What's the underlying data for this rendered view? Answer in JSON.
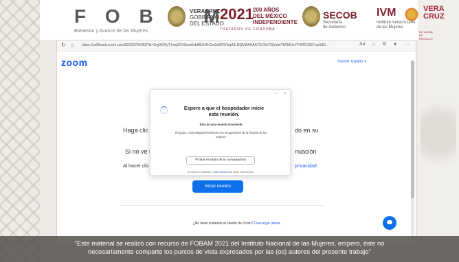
{
  "header": {
    "fobam": "F O B A M",
    "fobam_tagline": "Bienestar y Avance de las Mujeres",
    "veracruz_line1": "VERACRUZ",
    "veracruz_line2": "GOBIERNO",
    "veracruz_line3": "DEL ESTADO",
    "year": "2021",
    "anos_line1": "200 AÑOS",
    "anos_line2": "DEL MÉXICO",
    "anos_line3": "INDEPENDIENTE",
    "tratados": "TRATADOS DE CÓRDOBA",
    "secob": "SECOB",
    "secob_sub1": "Secretaría",
    "secob_sub2": "de Gobierno",
    "ivm": "IVM",
    "ivm_sub1": "Instituto Veracruzano",
    "ivm_sub2": "de las Mujeres",
    "vera_line1": "VERA",
    "vera_line2": "CRUZ",
    "vera_sub": "ME LLENA DE ORGULLO"
  },
  "browser": {
    "url": "https://us06web.zoom.us/s/82216794059?tk=9rg0KWyT7wq2OV5smAxbtf0UHKCkc5d4Z4YbqAE.DQMAAAAATXC9sY2ZndwTkRMUzYYWRCSEFuaXdD..."
  },
  "zoom": {
    "logo": "zoom",
    "support": "Soporte",
    "language": "Español ▾",
    "bg_line1_start": "Haga clic e",
    "bg_line1_end": "do en su",
    "bg_line2_start": "Si no ve u",
    "bg_line2_end": "nuación",
    "bg_line3_start": "Al hacer clic e",
    "bg_line3_end": "privacidad",
    "launch_button": "Iniciar reunión",
    "not_installed": "¿No tiene instalado el cliente de Zoom?",
    "download_link": "Descargar ahora"
  },
  "modal": {
    "minimize": "–",
    "close": "×",
    "title": "Espere a que el hospedador inicie esta reunión.",
    "recurring": "Esta es una reunión recurrente",
    "topic": "RAQUEL: Genealogías feministas y la recuperación de la historia de las mujeres",
    "audio_button": "Probar el audio de la computadora",
    "host_text_start": "Si usted es el anfitrión,",
    "host_link": "inicie sesión",
    "host_text_end": "para iniciar esta reunión."
  },
  "footer": {
    "line1": "\"Este material se realizó con recurso de FOBAM 2021 del Instituto Nacional de las Mujeres, empero, éste no",
    "line2": "necesariamente comparte los puntos de vista expresados por las (os) autores del presente trabajo\""
  },
  "colors": {
    "zoom_blue": "#0e71eb",
    "guinda": "#7a1f2b"
  }
}
